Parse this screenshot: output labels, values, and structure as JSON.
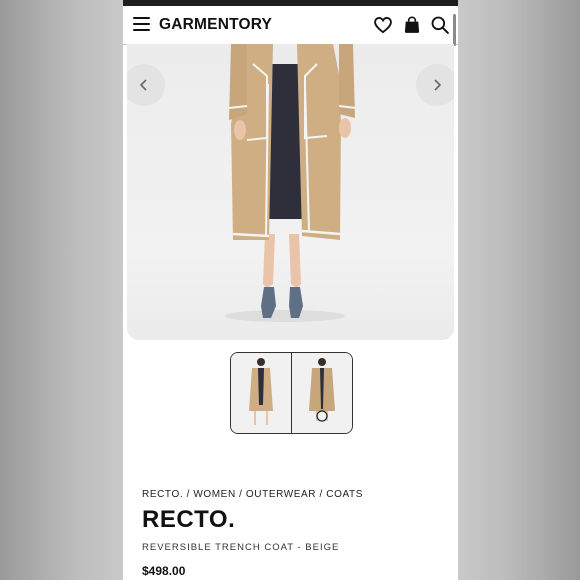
{
  "header": {
    "logo_text": "GARMENTORY",
    "icons": [
      "menu-icon",
      "heart-icon",
      "bag-icon",
      "search-icon"
    ]
  },
  "gallery": {
    "prev_icon": "chevron-left-icon",
    "next_icon": "chevron-right-icon",
    "thumbnail_count": 2
  },
  "product": {
    "breadcrumb": "RECTO. / WOMEN / OUTERWEAR / COATS",
    "brand": "RECTO.",
    "name": "REVERSIBLE TRENCH COAT - BEIGE",
    "price": "$498.00"
  },
  "colors": {
    "coat": "#cfae84",
    "trim": "#f4f4f4",
    "text": "#111111"
  }
}
